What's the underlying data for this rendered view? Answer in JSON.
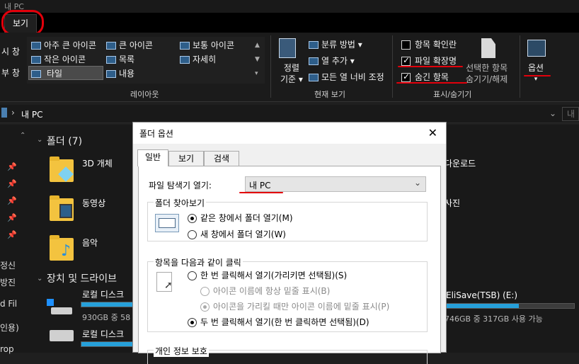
{
  "window": {
    "title": "내 PC"
  },
  "tabs": {
    "view": "보기"
  },
  "ribbon": {
    "layout": {
      "items": [
        "아주 큰 아이콘",
        "큰 아이콘",
        "보통 아이콘",
        "작은 아이콘",
        "목록",
        "자세히",
        "타일",
        "내용"
      ],
      "label": "레이아웃"
    },
    "current_view": {
      "sort_line1": "정렬",
      "sort_line2": "기준",
      "group_by": "분류 방법",
      "add_column": "열 추가",
      "fit_columns": "모든 열 너비 조정",
      "label": "현재 보기"
    },
    "show_hide": {
      "item_checkboxes": "항목 확인란",
      "file_extensions": "파일 확장명",
      "hidden_items": "숨긴 항목",
      "hide_selected_line1": "선택한 항목",
      "hide_selected_line2": "숨기기/해제",
      "label": "표시/숨기기"
    },
    "options": "옵션"
  },
  "address": {
    "path": "내 PC"
  },
  "content": {
    "folders_header": "폴더 (7)",
    "folders": [
      "3D 개체",
      "동영상",
      "음악"
    ],
    "right_folders": [
      "다운로드",
      "사진"
    ],
    "drives_header": "장치 및 드라이브",
    "drives": [
      {
        "name": "로컬 디스크",
        "size": "930GB 중 58",
        "used_fraction": 0.9
      },
      {
        "name": "로컬 디스크",
        "size": "",
        "used_fraction": 0.95
      }
    ],
    "usb": {
      "name": "EliSave(TSB) (E:)",
      "size": "746GB 중 317GB 사용 가능",
      "used_fraction": 0.57
    }
  },
  "nav_labels": [
    "창",
    "창",
    "정신",
    "방진",
    "d Fil",
    "인용)",
    "rop"
  ],
  "dialog": {
    "title": "폴더 옵션",
    "close": "✕",
    "tabs": [
      "일반",
      "보기",
      "검색"
    ],
    "open_in_label": "파일 탐색기 열기:",
    "open_in_value": "내 PC",
    "browse": {
      "legend": "폴더 찾아보기",
      "same_window": "같은 창에서 폴더 열기(M)",
      "new_window": "새 창에서 폴더 열기(W)"
    },
    "click": {
      "legend": "항목을 다음과 같이 클릭",
      "single": "한 번 클릭해서 열기(가리키면 선택됨)(S)",
      "underline_always": "아이콘 이름에 항상 밑줄 표시(B)",
      "underline_hover": "아이콘을 가리킬 때만 아이콘 이름에 밑줄 표시(P)",
      "double": "두 번 클릭해서 열기(한 번 클릭하면 선택됨)(D)"
    },
    "privacy_legend": "개인 정보 보호"
  }
}
